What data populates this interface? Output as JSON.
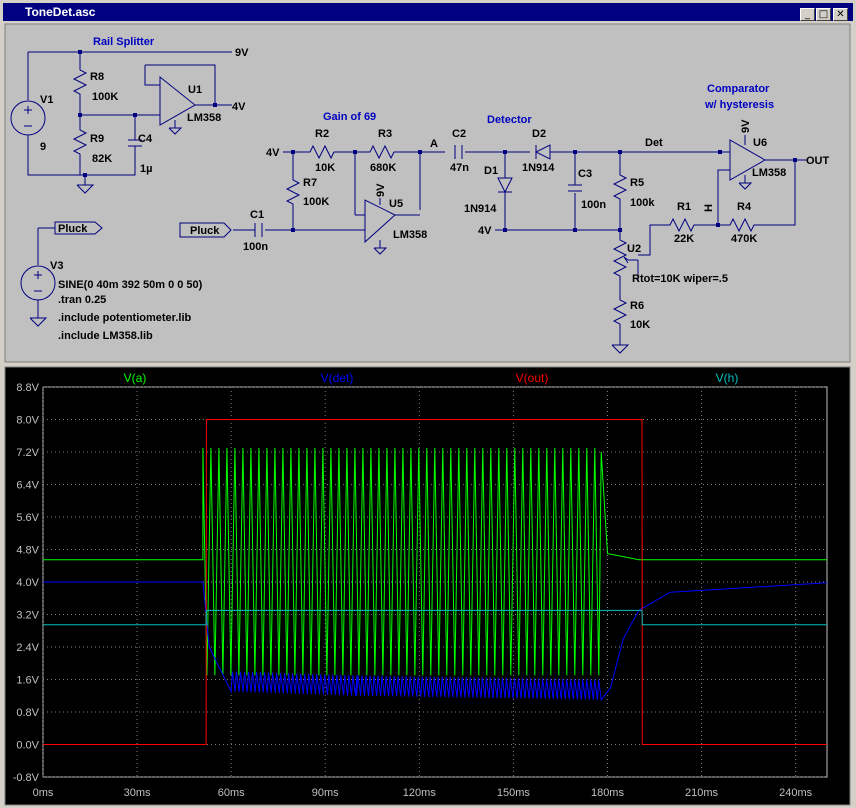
{
  "window": {
    "title": "ToneDet.asc",
    "buttons": [
      "_",
      "□",
      "✕"
    ]
  },
  "schematic": {
    "labels": {
      "rail_splitter": "Rail Splitter",
      "gain": "Gain of 69",
      "detector": "Detector",
      "comparator1": "Comparator",
      "comparator2": "w/ hysteresis",
      "v9a": "9V",
      "v4a": "4V",
      "v4b": "4V",
      "v4c": "4V",
      "v9u5": "9V",
      "v9u6": "9V",
      "v1": "V1",
      "v1val": "9",
      "r8": "R8",
      "r8val": "100K",
      "r9": "R9",
      "r9val": "82K",
      "c4": "C4",
      "c4val": "1µ",
      "u1": "U1",
      "u1m": "LM358",
      "r2": "R2",
      "r2val": "10K",
      "r3": "R3",
      "r3val": "680K",
      "r7": "R7",
      "r7val": "100K",
      "c1": "C1",
      "c1val": "100n",
      "u5": "U5",
      "u5m": "LM358",
      "pluck_in": "Pluck",
      "pluck_src": "Pluck",
      "node_a": "A",
      "c2": "C2",
      "c2val": "47n",
      "d1": "D1",
      "d1m": "1N914",
      "d2": "D2",
      "d2m": "1N914",
      "c3": "C3",
      "c3val": "100n",
      "r5": "R5",
      "r5val": "100k",
      "det": "Det",
      "r1": "R1",
      "r1val": "22K",
      "r4": "R4",
      "r4val": "470K",
      "h": "H",
      "u6": "U6",
      "u6m": "LM358",
      "out": "OUT",
      "u2": "U2",
      "u2val": "Rtot=10K wiper=.5",
      "r6": "R6",
      "r6val": "10K",
      "v3": "V3",
      "sine": "SINE(0 40m 392 50m 0 0 50)",
      "tran": ".tran 0.25",
      "inc1": ".include potentiometer.lib",
      "inc2": ".include LM358.lib"
    }
  },
  "waveform": {
    "traces": [
      {
        "name": "V(a)",
        "color": "#00ff00"
      },
      {
        "name": "V(det)",
        "color": "#0000ff"
      },
      {
        "name": "V(out)",
        "color": "#ff0000"
      },
      {
        "name": "V(h)",
        "color": "#00c0c0"
      }
    ],
    "yticks": [
      "8.8V",
      "8.0V",
      "7.2V",
      "6.4V",
      "5.6V",
      "4.8V",
      "4.0V",
      "3.2V",
      "2.4V",
      "1.6V",
      "0.8V",
      "0.0V",
      "-0.8V"
    ],
    "xticks": [
      "0ms",
      "30ms",
      "60ms",
      "90ms",
      "120ms",
      "150ms",
      "180ms",
      "210ms",
      "240ms"
    ],
    "yrange": [
      -0.8,
      8.8
    ],
    "xrange": [
      0,
      250
    ]
  },
  "chart_data": {
    "type": "line",
    "xlabel": "",
    "ylabel": "",
    "xlim": [
      0,
      250
    ],
    "ylim": [
      -0.8,
      8.8
    ],
    "grid": true,
    "x_unit": "ms",
    "y_unit": "V",
    "series": [
      {
        "name": "V(a)",
        "x": [
          0,
          51,
          52,
          60,
          100,
          140,
          178,
          180,
          190,
          250
        ],
        "y": [
          4.55,
          4.55,
          7.2,
          1.8,
          1.8,
          1.8,
          7.2,
          4.7,
          4.55,
          4.55
        ],
        "oscillation": {
          "x_range": [
            51,
            178
          ],
          "min": 1.7,
          "max": 7.3
        }
      },
      {
        "name": "V(det)",
        "x": [
          0,
          51,
          53,
          60,
          100,
          178,
          181,
          185,
          190,
          200,
          250
        ],
        "y": [
          4.0,
          4.0,
          2.4,
          1.3,
          1.2,
          1.1,
          1.4,
          2.6,
          3.3,
          3.75,
          3.98
        ]
      },
      {
        "name": "V(out)",
        "x": [
          0,
          52,
          52.1,
          191,
          191.1,
          250
        ],
        "y": [
          0.0,
          0.0,
          8.0,
          8.0,
          0.0,
          0.0
        ]
      },
      {
        "name": "V(h)",
        "x": [
          0,
          52,
          52.1,
          191,
          191.1,
          250
        ],
        "y": [
          2.95,
          2.95,
          3.3,
          3.3,
          2.95,
          2.95
        ]
      }
    ]
  }
}
